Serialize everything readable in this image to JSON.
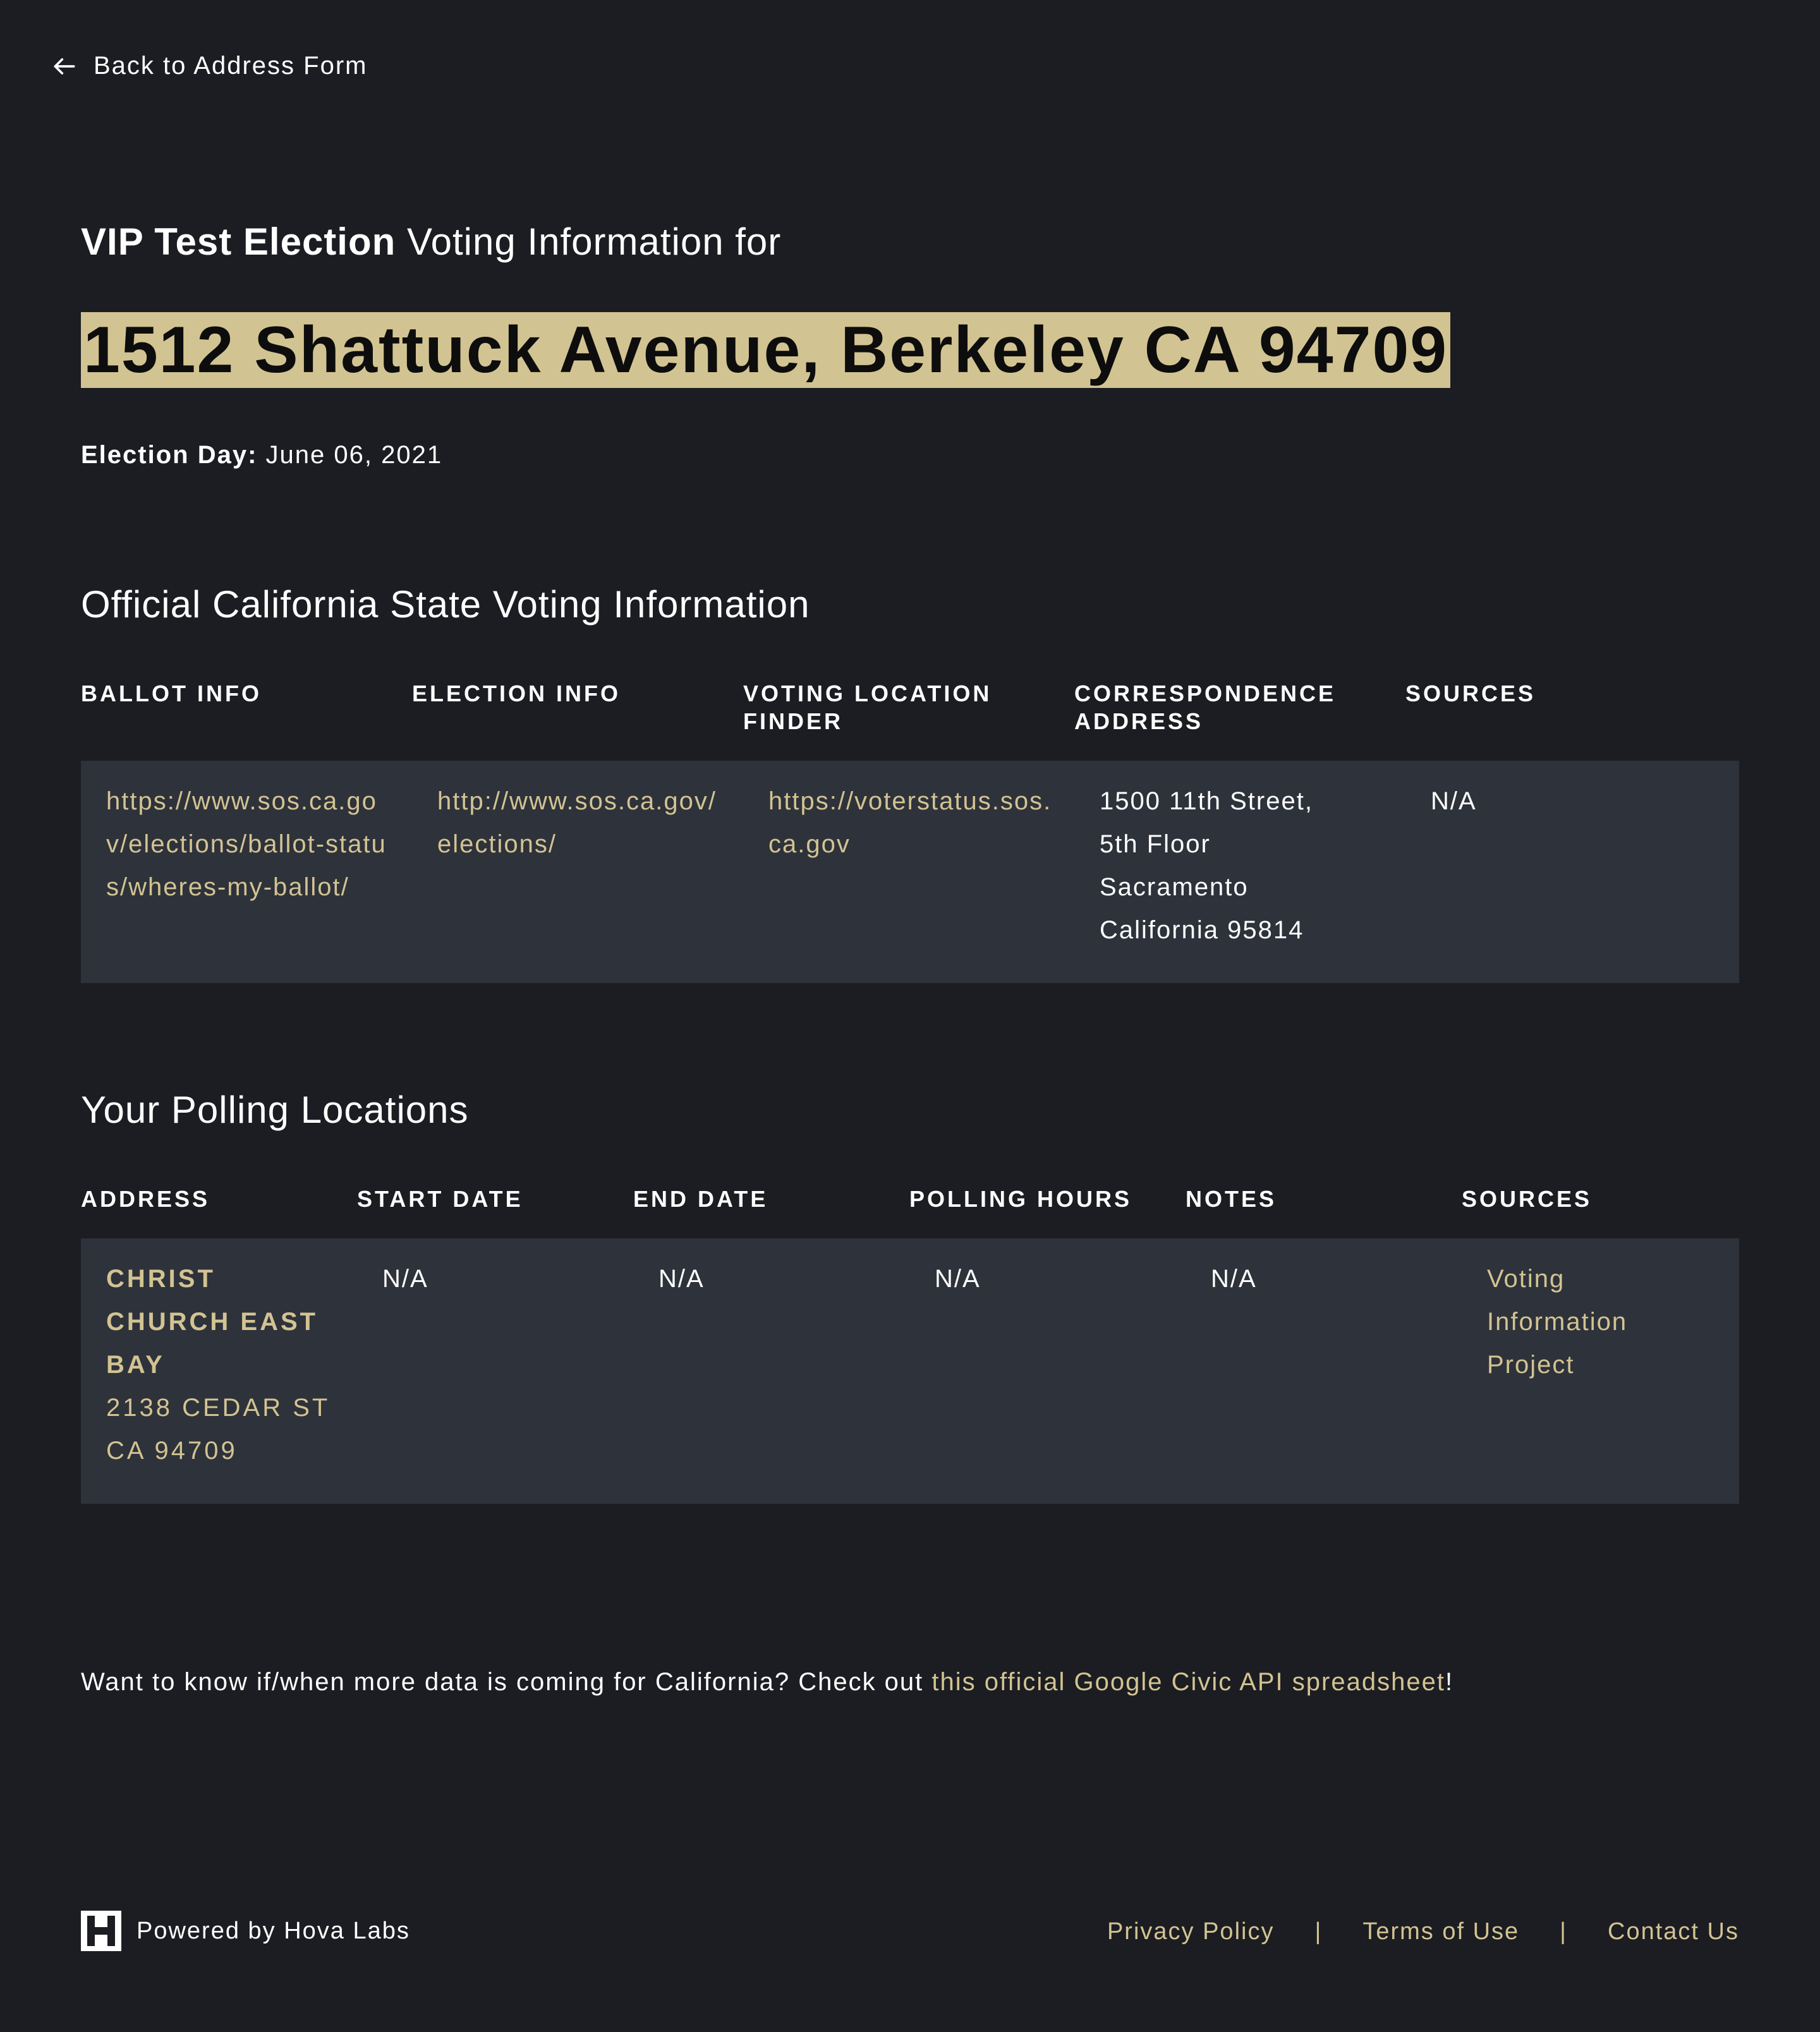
{
  "nav": {
    "back_label": "Back to Address Form"
  },
  "header": {
    "election_name": "VIP Test Election",
    "intro_suffix": "Voting Information for",
    "address": "1512 Shattuck Avenue, Berkeley CA 94709",
    "election_day_label": "Election Day:",
    "election_day_value": "June 06, 2021"
  },
  "state_info": {
    "title": "Official California State Voting Information",
    "columns": [
      "BALLOT INFO",
      "ELECTION INFO",
      "VOTING LOCATION FINDER",
      "CORRESPONDENCE ADDRESS",
      "SOURCES"
    ],
    "row": {
      "ballot_info": "https://www.sos.ca.gov/elections/ballot-status/wheres-my-ballot/",
      "election_info": "http://www.sos.ca.gov/elections/",
      "voting_location_finder": "https://voterstatus.sos.ca.gov",
      "correspondence_address": [
        "1500 11th Street,",
        "5th Floor",
        "Sacramento",
        "California 95814"
      ],
      "sources": "N/A"
    }
  },
  "polling": {
    "title": "Your Polling Locations",
    "columns": [
      "ADDRESS",
      "START DATE",
      "END DATE",
      "POLLING HOURS",
      "NOTES",
      "SOURCES"
    ],
    "row": {
      "location_name": [
        "CHRIST",
        "CHURCH EAST",
        "BAY"
      ],
      "location_street": "2138 CEDAR ST",
      "location_city": "CA 94709",
      "start_date": "N/A",
      "end_date": "N/A",
      "polling_hours": "N/A",
      "notes": "N/A",
      "sources": [
        "Voting",
        "Information",
        "Project"
      ]
    }
  },
  "footnote": {
    "text": "Want to know if/when more data is coming for California? Check out ",
    "link": "this official Google Civic API spreadsheet",
    "end": "!"
  },
  "footer": {
    "powered_by": "Powered by Hova Labs",
    "links": [
      "Privacy Policy",
      "Terms of Use",
      "Contact Us"
    ],
    "separator": "|",
    "accent_color": "#d2c392"
  }
}
